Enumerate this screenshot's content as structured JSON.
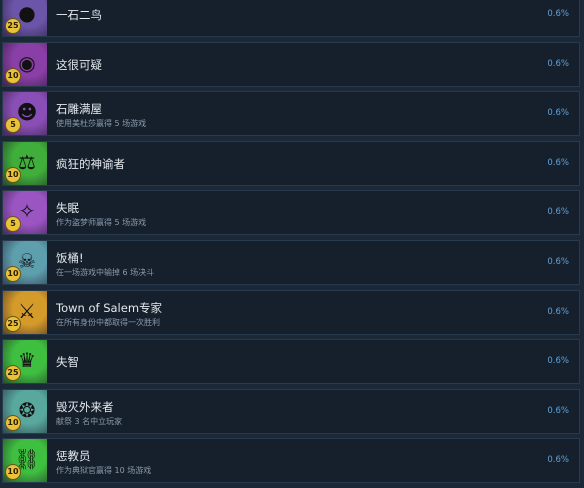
{
  "achievements": [
    {
      "title": "一石二鸟",
      "desc": "",
      "pct": "0.6%",
      "badge": "25",
      "icon": "dark-orb-icon",
      "bg": "#6b55a8"
    },
    {
      "title": "这很可疑",
      "desc": "",
      "pct": "0.6%",
      "badge": "10",
      "icon": "black-hole-icon",
      "bg": "#8a3fa6"
    },
    {
      "title": "石雕满屋",
      "desc": "使用美杜莎赢得 5 场游戏",
      "pct": "0.6%",
      "badge": "5",
      "icon": "medusa-icon",
      "bg": "#8a4fb6"
    },
    {
      "title": "疯狂的神谕者",
      "desc": "",
      "pct": "0.6%",
      "badge": "10",
      "icon": "scales-icon",
      "bg": "#3fae3a"
    },
    {
      "title": "失眠",
      "desc": "作为盗梦师赢得 5 场游戏",
      "pct": "0.6%",
      "badge": "5",
      "icon": "dreamcatcher-icon",
      "bg": "#9a55c2"
    },
    {
      "title": "饭桶!",
      "desc": "在一场游戏中输掉 6 场决斗",
      "pct": "0.6%",
      "badge": "10",
      "icon": "pirate-flag-icon",
      "bg": "#5e9fae"
    },
    {
      "title": "Town of Salem专家",
      "desc": "在所有身份中都取得一次胜利",
      "pct": "0.6%",
      "badge": "25",
      "icon": "sword-potion-icon",
      "bg": "#d49a2a"
    },
    {
      "title": "失智",
      "desc": "",
      "pct": "0.6%",
      "badge": "25",
      "icon": "crown-icon",
      "bg": "#3fbf3f"
    },
    {
      "title": "毁灭外来者",
      "desc": "献祭 3 名中立玩家",
      "pct": "0.6%",
      "badge": "10",
      "icon": "ritual-icon",
      "bg": "#58a89e"
    },
    {
      "title": "惩教员",
      "desc": "作为典狱官赢得 10 场游戏",
      "pct": "0.6%",
      "badge": "10",
      "icon": "shackles-icon",
      "bg": "#3fbf3f"
    }
  ],
  "glyphs": {
    "dark-orb-icon": "●",
    "black-hole-icon": "◉",
    "medusa-icon": "☻",
    "scales-icon": "⚖",
    "dreamcatcher-icon": "✧",
    "pirate-flag-icon": "☠",
    "sword-potion-icon": "⚔",
    "crown-icon": "♛",
    "ritual-icon": "❂",
    "shackles-icon": "⛓"
  }
}
